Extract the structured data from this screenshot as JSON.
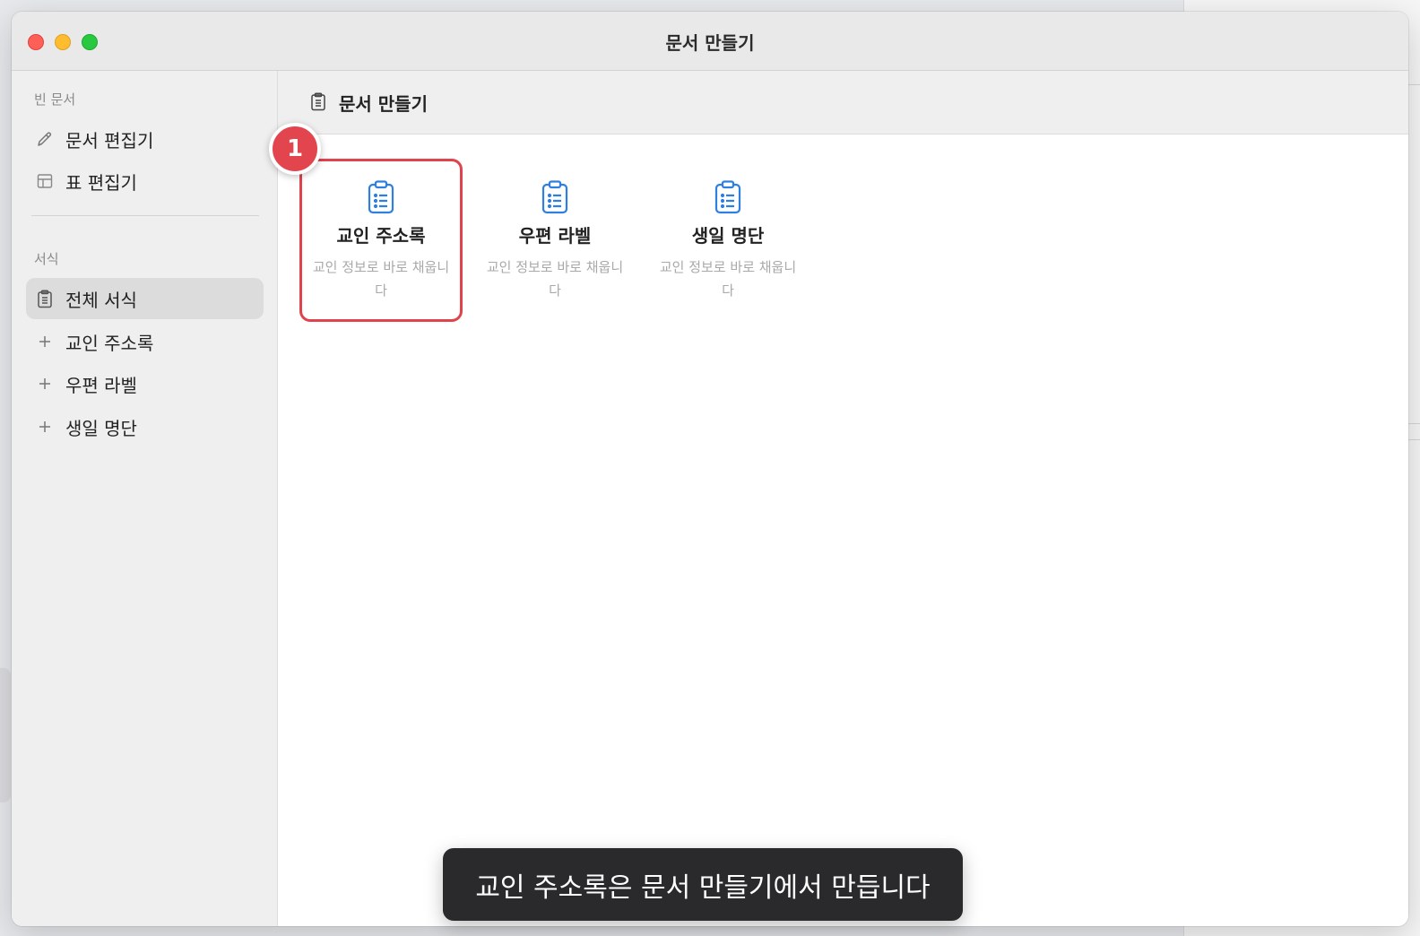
{
  "window": {
    "title": "문서 만들기"
  },
  "sidebar": {
    "blank_section_label": "빈 문서",
    "blank_items": [
      {
        "label": "문서 편집기",
        "icon": "pencil-icon"
      },
      {
        "label": "표 편집기",
        "icon": "table-icon"
      }
    ],
    "template_section_label": "서식",
    "template_items": [
      {
        "label": "전체 서식",
        "icon": "clipboard-icon",
        "active": true
      },
      {
        "label": "교인 주소록",
        "icon": "plus-icon"
      },
      {
        "label": "우편 라벨",
        "icon": "plus-icon"
      },
      {
        "label": "생일 명단",
        "icon": "plus-icon"
      }
    ]
  },
  "main": {
    "title": "문서 만들기",
    "cards": [
      {
        "title": "교인 주소록",
        "description": "교인 정보로 바로 채웁니다",
        "selected": true
      },
      {
        "title": "우편 라벨",
        "description": "교인 정보로 바로 채웁니다"
      },
      {
        "title": "생일 명단",
        "description": "교인 정보로 바로 채웁니다"
      }
    ]
  },
  "annotation": {
    "badge_number": "1"
  },
  "toast": {
    "message": "교인 주소록은 문서 만들기에서 만듭니다"
  },
  "colors": {
    "accent_blue": "#2f7fe0",
    "highlight_red": "#e0434c"
  }
}
